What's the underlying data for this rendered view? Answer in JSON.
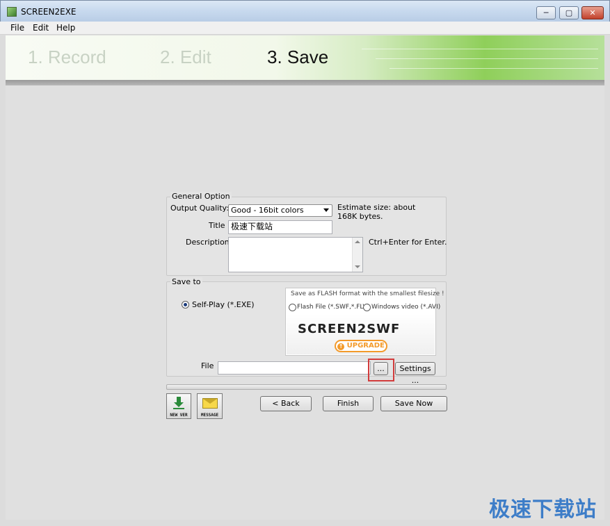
{
  "window": {
    "title": "SCREEN2EXE",
    "minimize_label": "─",
    "maximize_label": "▢",
    "close_label": "✕"
  },
  "menu": [
    "File",
    "Edit",
    "Help"
  ],
  "steps": [
    "1. Record",
    "2. Edit",
    "3. Save"
  ],
  "active_step": 2,
  "general": {
    "group_label": "General Option",
    "quality_label": "Output Quality:",
    "quality_value": "Good - 16bit colors",
    "estimate_text": "Estimate size: about 168K bytes.",
    "title_label": "Title",
    "title_value": "极速下载站",
    "description_label": "Description",
    "description_value": "",
    "description_hint": "Ctrl+Enter for Enter."
  },
  "save_to": {
    "group_label": "Save to",
    "selfplay_label": "Self-Play (*.EXE)",
    "selfplay_checked": true,
    "promo": {
      "headline": "Save as FLASH format with the smallest filesize !",
      "option_flash": "Flash File (*.SWF,*.FLV)",
      "option_video": "Windows video (*.AVI)",
      "logo_text": "SCREEN2SWF",
      "upgrade_label": "UPGRADE"
    },
    "file_label": "File",
    "file_value": "",
    "browse_label": "...",
    "settings_label": "Settings ..."
  },
  "bottom": {
    "new_ver_label": "NEW VER",
    "message_label": "MESSAGE",
    "back_label": "< Back",
    "finish_label": "Finish",
    "save_now_label": "Save Now"
  },
  "watermark": "极速下载站",
  "colors": {
    "highlight": "#d23b3b",
    "accent_green": "#8fcf5a",
    "upgrade_orange": "#f39a2a"
  }
}
